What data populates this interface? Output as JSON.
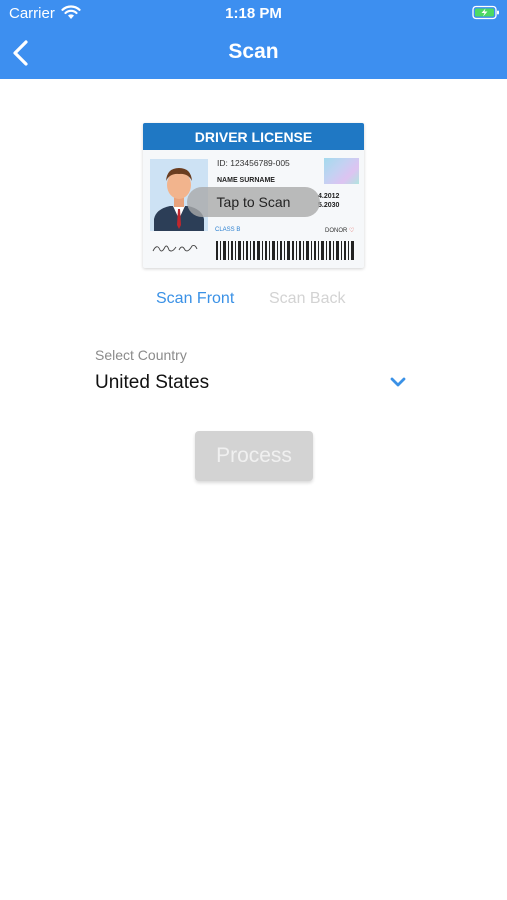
{
  "status_bar": {
    "carrier": "Carrier",
    "time": "1:18 PM"
  },
  "nav": {
    "title": "Scan",
    "back_icon": "chevron-left-icon"
  },
  "card": {
    "header": "DRIVER LICENSE",
    "id": "ID: 123456789-005",
    "name": "NAME SURNAME",
    "date1": "4.2012",
    "date2": "5.2030",
    "class": "CLASS   B",
    "donor": "DONOR",
    "tap_label": "Tap to Scan"
  },
  "scan_tabs": {
    "front": "Scan Front",
    "back": "Scan Back"
  },
  "country": {
    "label": "Select Country",
    "value": "United States"
  },
  "process_label": "Process",
  "colors": {
    "accent": "#3d8ff0",
    "link": "#3a91e6",
    "disabled": "#d3d3d3"
  }
}
